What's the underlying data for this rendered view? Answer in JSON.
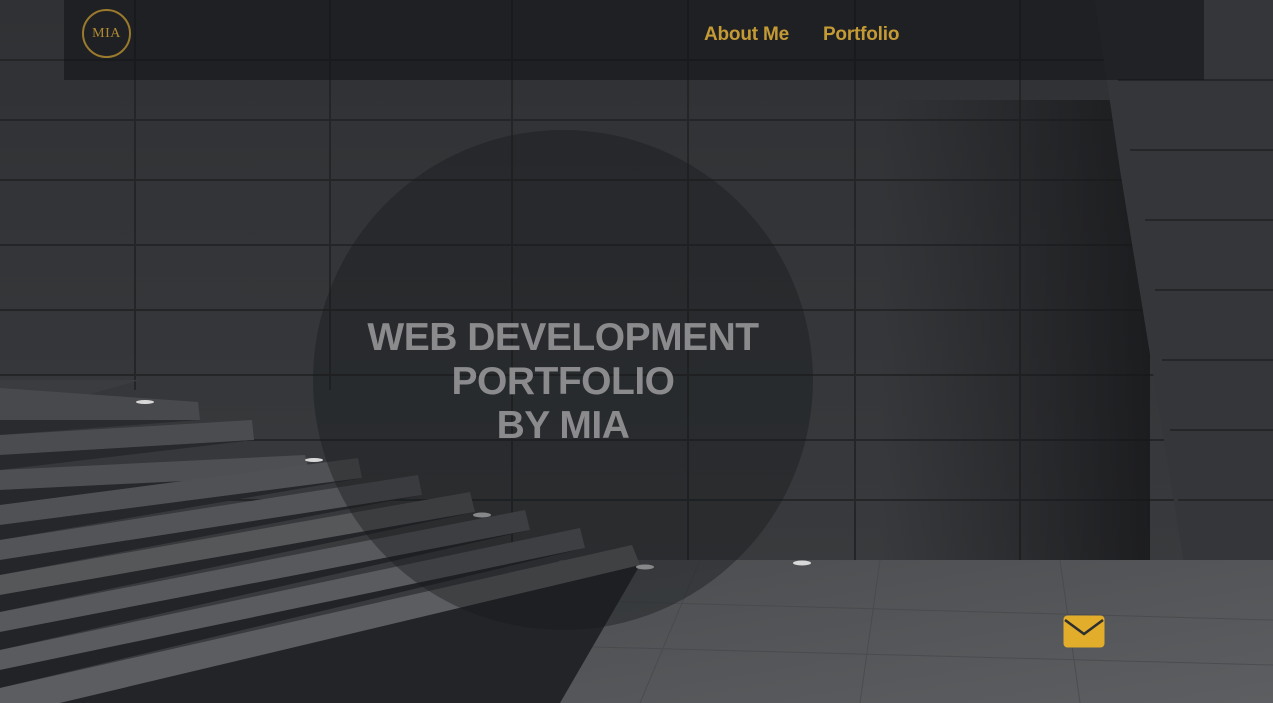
{
  "nav": {
    "logo_text": "MIA",
    "links": [
      {
        "label": "About Me"
      },
      {
        "label": "Portfolio"
      }
    ]
  },
  "hero": {
    "title_lines": [
      "WEB DEVELOPMENT",
      "PORTFOLIO",
      "BY MIA"
    ]
  },
  "contact": {
    "icon": "envelope-icon"
  },
  "colors": {
    "accent": "#c49a35",
    "logo_border": "#9a7a2c",
    "headline": "#8b8b8d",
    "mail_icon": "#e2ad2a"
  }
}
